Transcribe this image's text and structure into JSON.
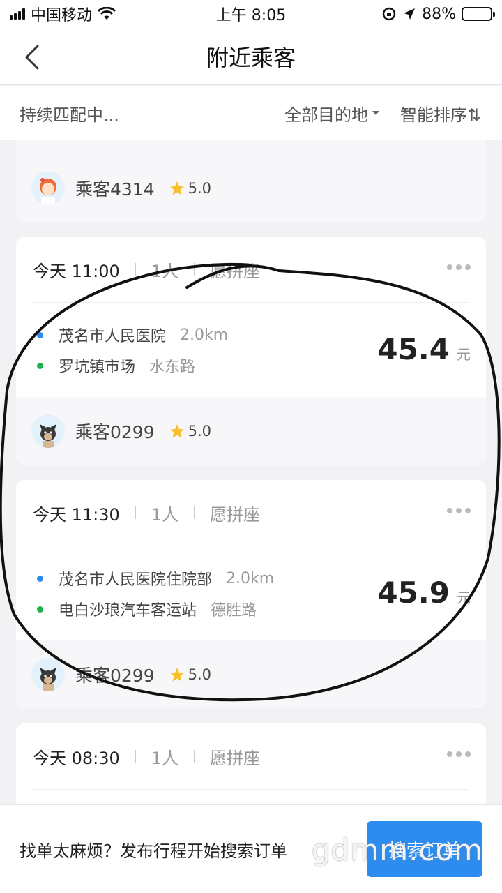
{
  "status_bar": {
    "carrier": "中国移动",
    "time": "上午 8:05",
    "battery": "88%",
    "battery_level": 0.88,
    "icons": [
      "signal-icon",
      "wifi-icon",
      "lock-rotation-icon",
      "location-arrow-icon",
      "battery-icon"
    ]
  },
  "nav": {
    "title": "附近乘客",
    "back_icon": "chevron-left-icon"
  },
  "filter": {
    "matching": "持续匹配中...",
    "destination": "全部目的地",
    "sort": "智能排序⇅"
  },
  "cards": [
    {
      "passenger": "乘客4314",
      "rating": "5.0",
      "avatar": "girl-avatar"
    },
    {
      "time": "今天 11:00",
      "people": "1人",
      "seat": "愿拼座",
      "from": "茂名市人民医院",
      "from_distance": "2.0km",
      "to": "罗坑镇市场",
      "to_road": "水东路",
      "price": "45.4",
      "unit": "元",
      "passenger": "乘客0299",
      "rating": "5.0",
      "avatar": "dog-avatar"
    },
    {
      "time": "今天 11:30",
      "people": "1人",
      "seat": "愿拼座",
      "from": "茂名市人民医院住院部",
      "from_distance": "2.0km",
      "to": "电白沙琅汽车客运站",
      "to_road": "德胜路",
      "price": "45.9",
      "unit": "元",
      "passenger": "乘客0299",
      "rating": "5.0",
      "avatar": "dog-avatar"
    },
    {
      "time": "今天 08:30",
      "people": "1人",
      "seat": "愿拼座"
    }
  ],
  "bottom": {
    "prompt": "找单太麻烦？发布行程开始搜索订单",
    "button": "搜索订单"
  },
  "watermark": "gdmm.com",
  "colors": {
    "accent": "#2d8cf0",
    "origin_dot": "#2d8cf0",
    "destination_dot": "#1fb14a",
    "star": "#f7c02b"
  }
}
